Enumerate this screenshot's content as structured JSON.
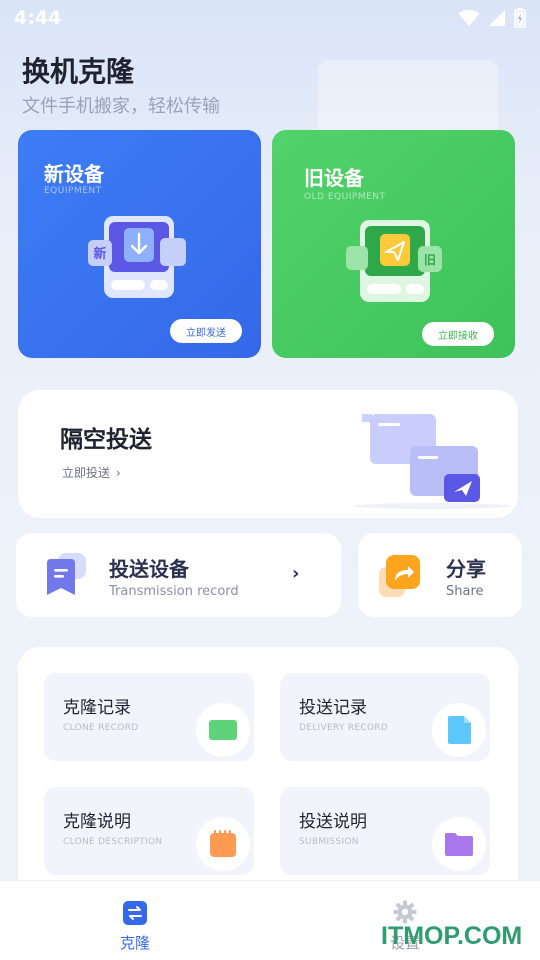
{
  "status_bar": {
    "time": "4:44",
    "icons": [
      "wifi-icon",
      "cell-signal-icon",
      "battery-charging-icon"
    ]
  },
  "header": {
    "title": "换机克隆",
    "subtitle": "文件手机搬家，轻松传输"
  },
  "new_device": {
    "title": "新设备",
    "subtitle": "EQUIPMENT",
    "badge": "新",
    "button": "立即发送",
    "color": "#3568e8"
  },
  "old_device": {
    "title": "旧设备",
    "subtitle": "OLD EQUIPMENT",
    "badge": "旧",
    "button": "立即接收",
    "color": "#3fc25a"
  },
  "airdrop": {
    "title": "隔空投送",
    "link": "立即投送",
    "chevron": "›"
  },
  "transmission": {
    "title": "投送设备",
    "subtitle": "Transmission record",
    "chevron": "›"
  },
  "share": {
    "title": "分享",
    "subtitle": "Share"
  },
  "tiles": [
    {
      "title": "克隆记录",
      "subtitle": "CLONE RECORD",
      "icon": "green-card-icon",
      "color": "#5fd37a"
    },
    {
      "title": "投送记录",
      "subtitle": "DELIVERY RECORD",
      "icon": "blue-file-icon",
      "color": "#5cc7f8"
    },
    {
      "title": "克隆说明",
      "subtitle": "CLONE DESCRIPTION",
      "icon": "orange-notepad-icon",
      "color": "#ff9a52"
    },
    {
      "title": "投送说明",
      "subtitle": "SUBMISSION",
      "icon": "purple-folder-icon",
      "color": "#a877ec"
    }
  ],
  "bottom_nav": {
    "items": [
      {
        "label": "克隆",
        "icon": "swap-icon",
        "active": true
      },
      {
        "label": "设置",
        "icon": "gear-icon",
        "active": false
      }
    ]
  },
  "watermark": "ITMOP.COM"
}
